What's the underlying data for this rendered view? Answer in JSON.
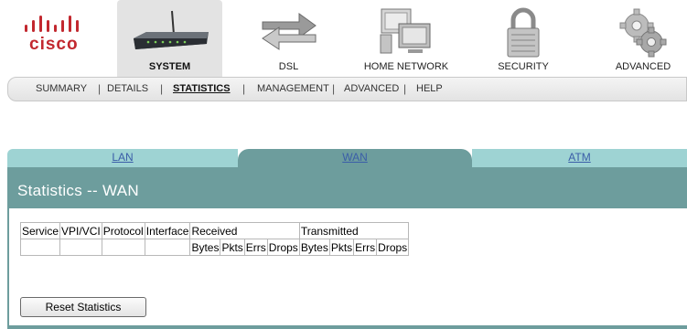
{
  "brand": {
    "name": "cisco"
  },
  "nav": {
    "items": [
      {
        "label": "SYSTEM",
        "icon": "router-icon",
        "active": true
      },
      {
        "label": "DSL",
        "icon": "transfer-arrows-icon",
        "active": false
      },
      {
        "label": "HOME NETWORK",
        "icon": "network-computers-icon",
        "active": false
      },
      {
        "label": "SECURITY",
        "icon": "padlock-icon",
        "active": false
      },
      {
        "label": "ADVANCED",
        "icon": "gears-icon",
        "active": false
      }
    ]
  },
  "subnav": {
    "items": [
      {
        "label": "SUMMARY"
      },
      {
        "label": "DETAILS"
      },
      {
        "label": "STATISTICS",
        "active": true
      },
      {
        "label": "MANAGEMENT"
      },
      {
        "label": "ADVANCED"
      },
      {
        "label": "HELP"
      }
    ],
    "separator": "|"
  },
  "tabs": [
    {
      "label": "LAN"
    },
    {
      "label": "WAN",
      "active": true
    },
    {
      "label": "ATM"
    }
  ],
  "panel": {
    "title": "Statistics -- WAN"
  },
  "table": {
    "headers": [
      "Service",
      "VPI/VCI",
      "Protocol",
      "Interface",
      "Received",
      "Transmitted"
    ],
    "subheaders": [
      "Bytes",
      "Pkts",
      "Errs",
      "Drops",
      "Bytes",
      "Pkts",
      "Errs",
      "Drops"
    ]
  },
  "actions": {
    "reset_label": "Reset Statistics"
  },
  "colors": {
    "logo_red": "#c2282f",
    "panel": "#6d9d9d",
    "tab_inactive": "#9ed3d3",
    "tab_link": "#3b5ea8"
  }
}
